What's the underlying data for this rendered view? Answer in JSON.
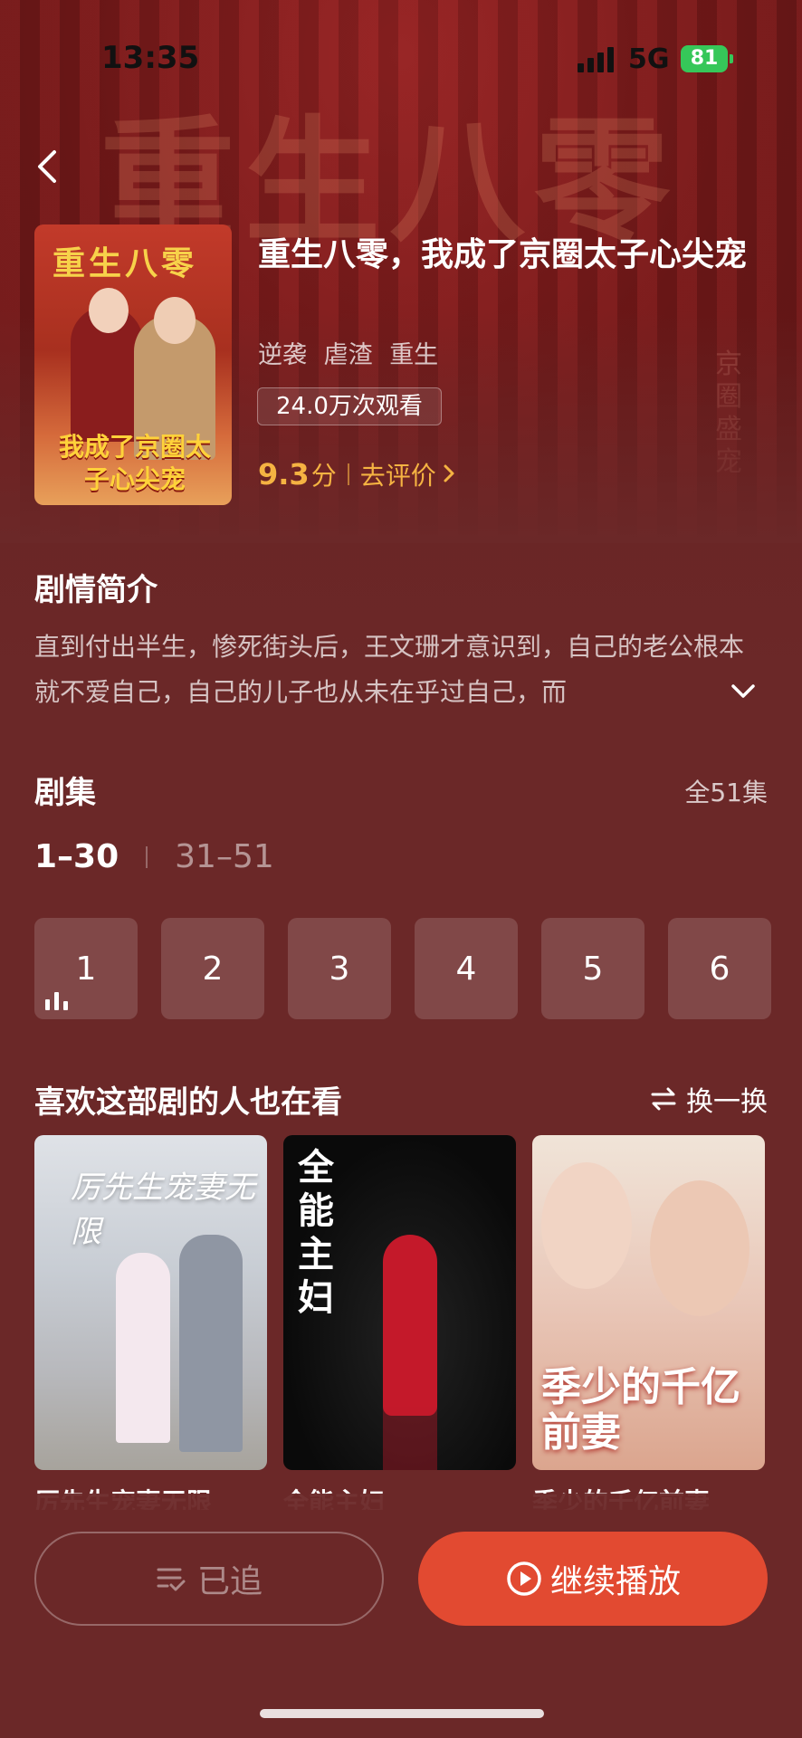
{
  "status_bar": {
    "time": "13:35",
    "network": "5G",
    "battery": "81"
  },
  "hero": {
    "bg_title": "重生八零",
    "bg_subtitle": "京圈盛宠"
  },
  "show": {
    "poster_title": "重生八零",
    "poster_bottom": "我成了京圈太子心尖宠",
    "title": "重生八零，我成了京圈太子心尖宠",
    "tags": [
      "逆袭",
      "虐渣",
      "重生"
    ],
    "views": "24.0万次观看",
    "score": "9.3",
    "score_unit": "分",
    "rate_link": "去评价"
  },
  "synopsis": {
    "title": "剧情简介",
    "text": "直到付出半生，惨死街头后，王文珊才意识到，自己的老公根本就不爱自己，自己的儿子也从未在乎过自己，而"
  },
  "episodes": {
    "title": "剧集",
    "total": "全51集",
    "ranges": [
      "1–30",
      "31–51"
    ],
    "active_range": 0,
    "items": [
      "1",
      "2",
      "3",
      "4",
      "5",
      "6"
    ],
    "playing_index": 0
  },
  "recommendations": {
    "title": "喜欢这部剧的人也在看",
    "refresh_label": "换一换",
    "items": [
      {
        "name": "厉先生宠妻无限",
        "cover_text": "厉先生宠妻无限"
      },
      {
        "name": "全能主妇",
        "cover_text": "全能主妇"
      },
      {
        "name": "季少的千亿前妻",
        "cover_text": "季少的千亿前妻"
      }
    ]
  },
  "actions": {
    "follow_label": "已追",
    "play_label": "继续播放"
  },
  "colors": {
    "background": "#6b2828",
    "accent": "#e24a31",
    "rating": "#f5b342"
  }
}
